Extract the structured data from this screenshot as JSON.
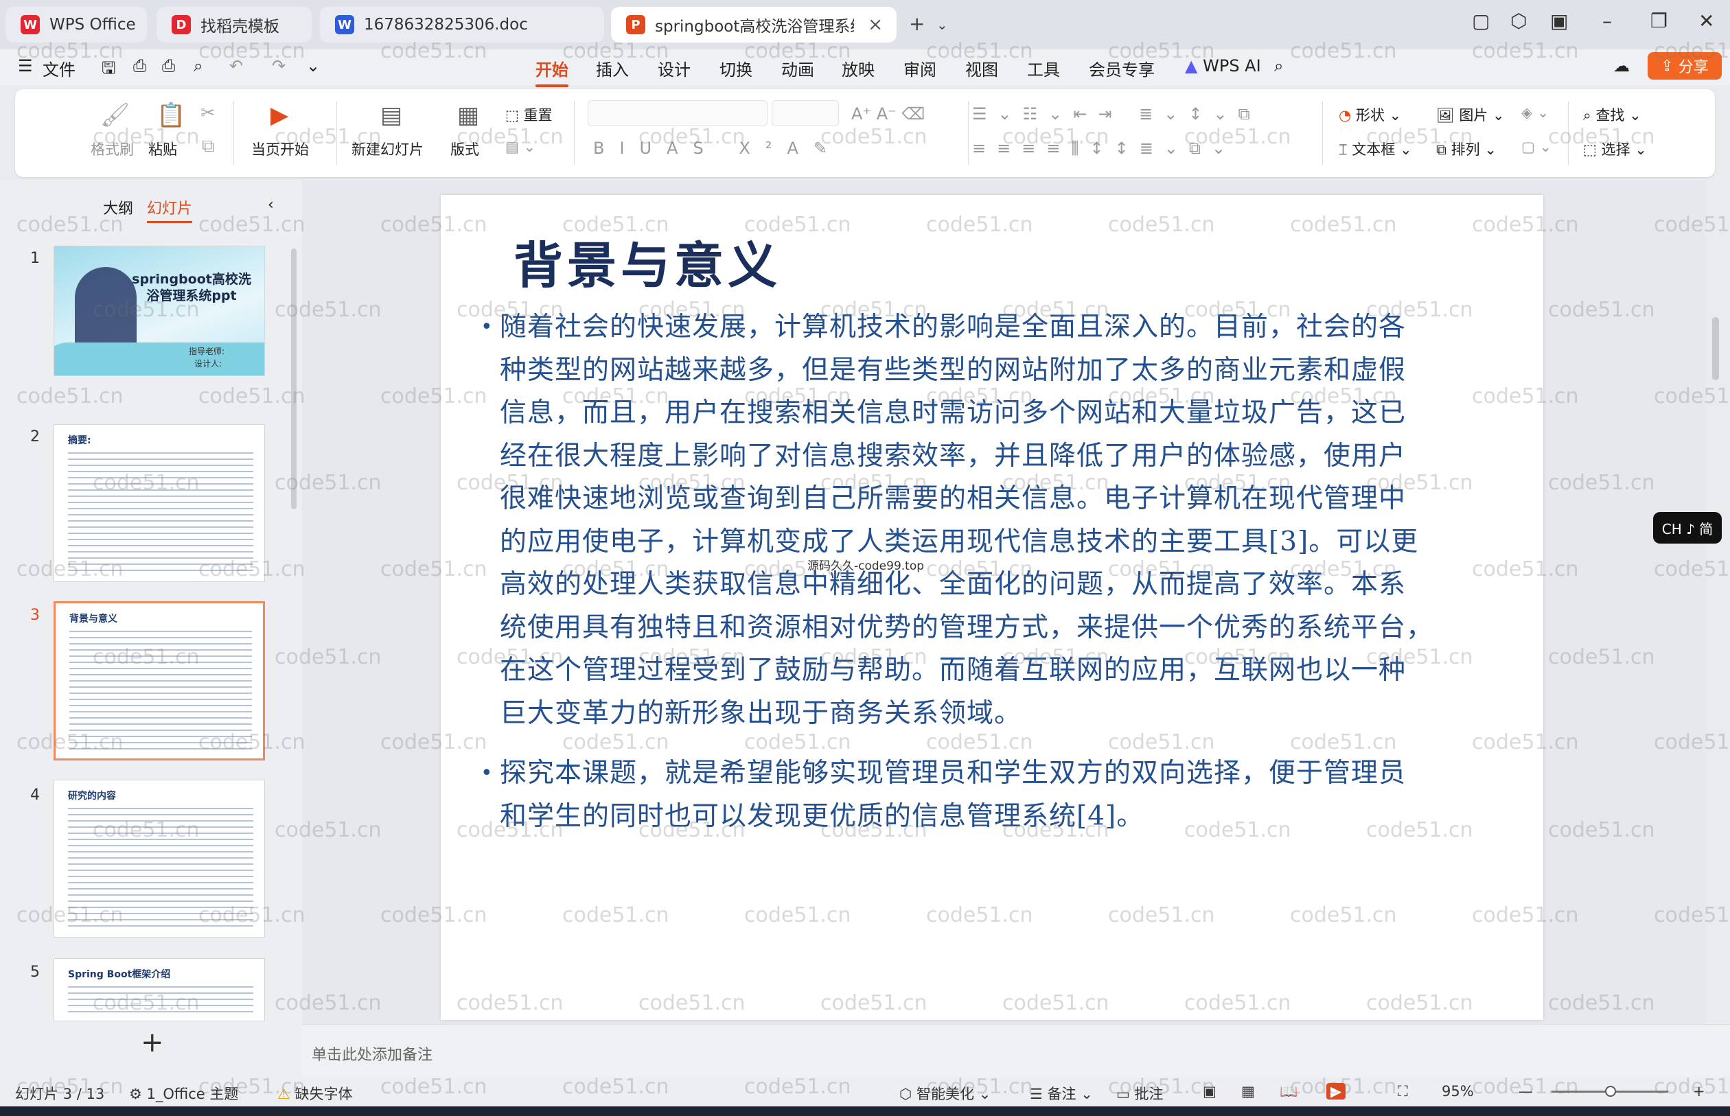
{
  "tabs": [
    {
      "label": "WPS Office",
      "logo": "W",
      "color": "#e3262f"
    },
    {
      "label": "找稻壳模板",
      "logo": "D",
      "color": "#e3262f"
    },
    {
      "label": "1678632825306.doc",
      "logo": "W",
      "color": "#2f5cd7"
    },
    {
      "label": "springboot高校洗浴管理系统",
      "logo": "P",
      "color": "#e04a1c"
    }
  ],
  "menu": {
    "file": "文件",
    "items": [
      "开始",
      "插入",
      "设计",
      "切换",
      "动画",
      "放映",
      "审阅",
      "视图",
      "工具",
      "会员专享"
    ],
    "ai": "WPS AI",
    "share": "分享"
  },
  "ribbon": {
    "format_painter": "格式刷",
    "paste": "粘贴",
    "play_current": "当页开始",
    "new_slide": "新建幻灯片",
    "layout": "版式",
    "reset": "重置",
    "shape": "形状",
    "picture": "图片",
    "textbox": "文本框",
    "arrange": "排列",
    "find": "查找",
    "select": "选择"
  },
  "panel": {
    "outline": "大纲",
    "slides": "幻灯片"
  },
  "thumbs": [
    {
      "num": "1",
      "title": "springboot高校洗浴管理系统ppt",
      "sub1": "指导老师:",
      "sub2": "设计人:"
    },
    {
      "num": "2",
      "title": "摘要:"
    },
    {
      "num": "3",
      "title": "背景与意义"
    },
    {
      "num": "4",
      "title": "研究的内容"
    },
    {
      "num": "5",
      "title": "Spring Boot框架介绍"
    }
  ],
  "slide": {
    "title": "背景与意义",
    "p1": [
      "随着社会的快速发展，计算机技术的影响是全面且深入的。目前，社会的各",
      "种类型的网站越来越多，但是有些类型的网站附加了太多的商业元素和虚假",
      "信息，而且，用户在搜索相关信息时需访问多个网站和大量垃圾广告，这已",
      "经在很大程度上影响了对信息搜索效率，并且降低了用户的体验感，使用户",
      "很难快速地浏览或查询到自己所需要的相关信息。电子计算机在现代管理中",
      "的应用使电子，计算机变成了人类运用现代信息技术的主要工具[3]。可以更",
      "高效的处理人类获取信息中精细化、全面化的问题，从而提高了效率。本系",
      "统使用具有独特且和资源相对优势的管理方式，来提供一个优秀的系统平台，",
      "在这个管理过程受到了鼓励与帮助。而随着互联网的应用，互联网也以一种",
      "巨大变革力的新形象出现于商务关系领域。"
    ],
    "p2": [
      "探究本课题，就是希望能够实现管理员和学生双方的双向选择，便于管理员",
      "和学生的同时也可以发现更优质的信息管理系统[4]。"
    ],
    "overlay": "源码久久-code99.top"
  },
  "ime": "CH ♪ 简",
  "notes": "单击此处添加备注",
  "status": {
    "slide": "幻灯片 3 / 13",
    "theme": "1_Office 主题",
    "missing_font": "缺失字体",
    "beautify": "智能美化",
    "notes": "备注",
    "comment": "批注",
    "zoom": "95%"
  },
  "watermark": "code51.cn"
}
